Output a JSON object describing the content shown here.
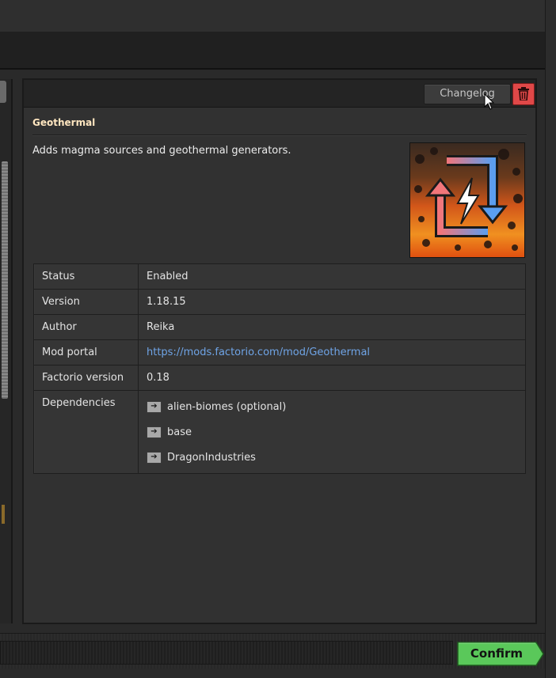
{
  "mod": {
    "title": "Geothermal",
    "description": "Adds magma sources and geothermal generators.",
    "thumbnail_icon": "geothermal-thumbnail"
  },
  "toolbar": {
    "changelog_label": "Changelog",
    "delete_icon": "trash-icon"
  },
  "details": {
    "status": {
      "label": "Status",
      "value": "Enabled"
    },
    "version": {
      "label": "Version",
      "value": "1.18.15"
    },
    "author": {
      "label": "Author",
      "value": "Reika"
    },
    "portal": {
      "label": "Mod portal",
      "value": "https://mods.factorio.com/mod/Geothermal"
    },
    "factorio": {
      "label": "Factorio version",
      "value": "0.18"
    },
    "dependencies": {
      "label": "Dependencies",
      "items": [
        "alien-biomes (optional)",
        "base",
        "DragonIndustries"
      ]
    }
  },
  "footer": {
    "confirm_label": "Confirm"
  },
  "colors": {
    "title": "#ffe6c0",
    "link": "#6fa4e6",
    "delete": "#e04848",
    "confirm": "#5ac85a"
  }
}
